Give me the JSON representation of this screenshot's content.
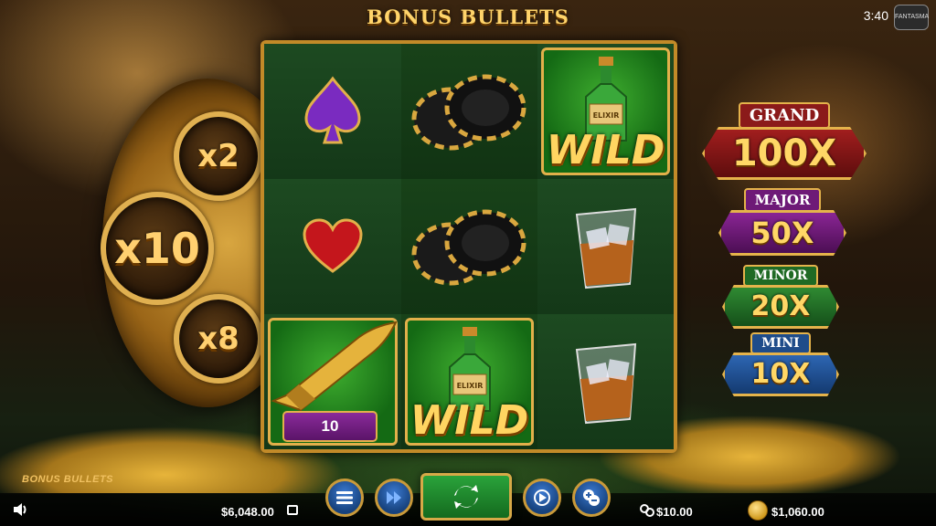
{
  "header": {
    "title": "BONUS BULLETS",
    "clock": "3:40",
    "studio_logo": "FANTASMA"
  },
  "cylinder": {
    "multipliers": [
      "x2",
      "x10",
      "x8"
    ]
  },
  "reels": {
    "cells": [
      [
        "purple-spade-icon",
        "black-chips-icon",
        "wild-bottle"
      ],
      [
        "red-heart-icon",
        "black-chips-icon",
        "whiskey-glass-icon"
      ],
      [
        "gold-bullet",
        "wild-bottle",
        "whiskey-glass-icon"
      ]
    ],
    "wild_label": "WILD",
    "bottle_label": "ELIXIR",
    "bullet_value": "10"
  },
  "jackpots": {
    "grand": {
      "label": "GRAND",
      "value": "100X"
    },
    "major": {
      "label": "MAJOR",
      "value": "50X"
    },
    "minor": {
      "label": "MINOR",
      "value": "20X"
    },
    "mini": {
      "label": "MINI",
      "value": "10X"
    }
  },
  "footer": {
    "game_logo": "BONUS BULLETS",
    "balance": "$6,048.00",
    "bet": "$10.00",
    "win": "$1,060.00"
  },
  "colors": {
    "gold": "#e2b04a",
    "felt": "#1d4a21",
    "button_blue": "#2b5fa8",
    "spin_green": "#1f8c2e"
  }
}
